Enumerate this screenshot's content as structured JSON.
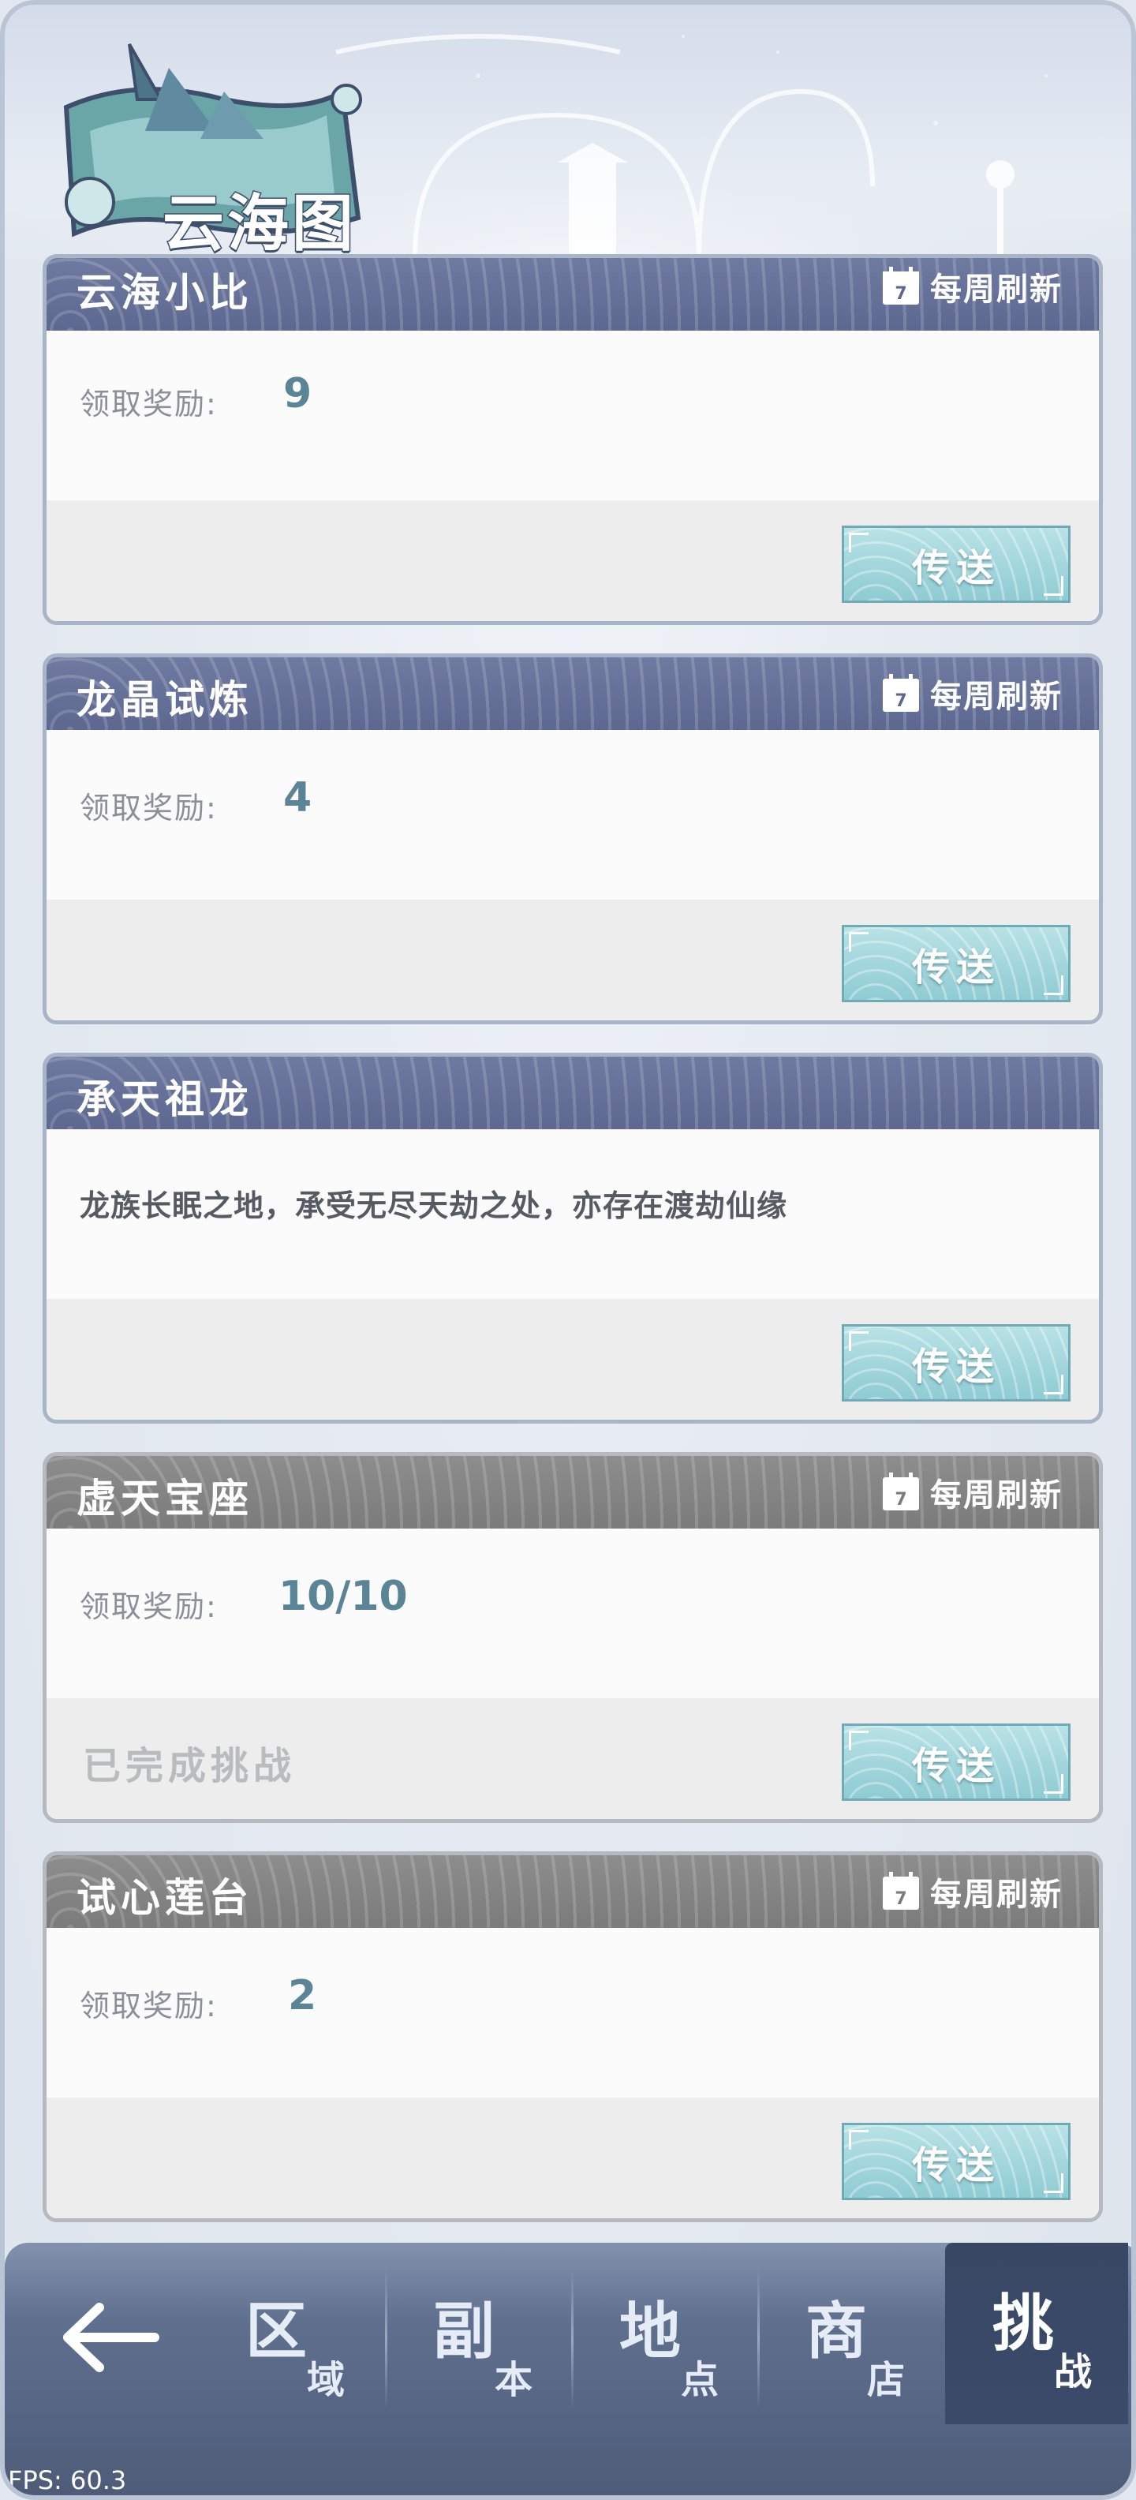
{
  "header": {
    "title": "云海图"
  },
  "common": {
    "refresh_label": "每周刷新",
    "calendar_day": "7",
    "reward_label": "领取奖励:",
    "go_label": "传送"
  },
  "cards": [
    {
      "title": "云海小比",
      "reward": "9",
      "status": "active"
    },
    {
      "title": "龙晶试炼",
      "reward": "4",
      "status": "active"
    },
    {
      "title": "承天祖龙",
      "description": "龙族长眠之地，承受无尽天劫之处，亦存在渡劫仙缘",
      "status": "active"
    },
    {
      "title": "虚天宝座",
      "reward": "10/10",
      "status": "completed",
      "completed_text": "已完成挑战"
    },
    {
      "title": "试心莲台",
      "reward": "2",
      "status": "grey"
    }
  ],
  "nav": {
    "tabs": [
      {
        "big": "区",
        "small": "域"
      },
      {
        "big": "副",
        "small": "本"
      },
      {
        "big": "地",
        "small": "点"
      },
      {
        "big": "商",
        "small": "店"
      },
      {
        "big": "挑",
        "small": "战",
        "active": true
      }
    ]
  },
  "fps": "FPS: 60.3"
}
